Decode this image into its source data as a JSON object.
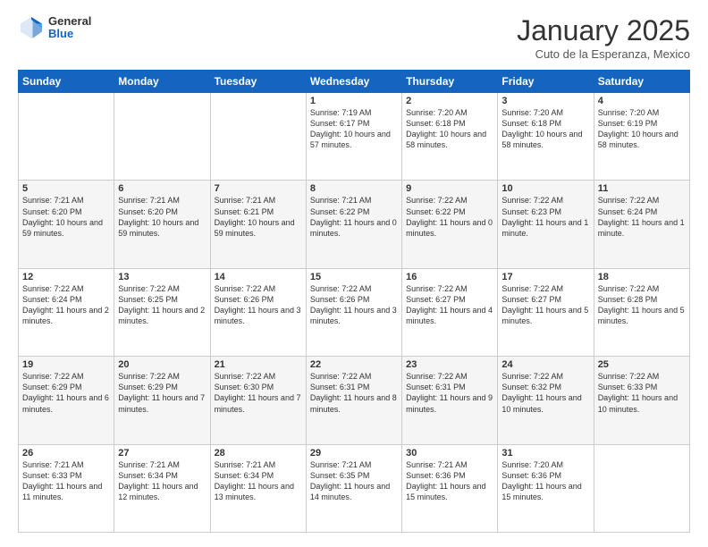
{
  "logo": {
    "general": "General",
    "blue": "Blue"
  },
  "header": {
    "month": "January 2025",
    "location": "Cuto de la Esperanza, Mexico"
  },
  "days_of_week": [
    "Sunday",
    "Monday",
    "Tuesday",
    "Wednesday",
    "Thursday",
    "Friday",
    "Saturday"
  ],
  "weeks": [
    [
      {
        "day": "",
        "info": ""
      },
      {
        "day": "",
        "info": ""
      },
      {
        "day": "",
        "info": ""
      },
      {
        "day": "1",
        "info": "Sunrise: 7:19 AM\nSunset: 6:17 PM\nDaylight: 10 hours and 57 minutes."
      },
      {
        "day": "2",
        "info": "Sunrise: 7:20 AM\nSunset: 6:18 PM\nDaylight: 10 hours and 58 minutes."
      },
      {
        "day": "3",
        "info": "Sunrise: 7:20 AM\nSunset: 6:18 PM\nDaylight: 10 hours and 58 minutes."
      },
      {
        "day": "4",
        "info": "Sunrise: 7:20 AM\nSunset: 6:19 PM\nDaylight: 10 hours and 58 minutes."
      }
    ],
    [
      {
        "day": "5",
        "info": "Sunrise: 7:21 AM\nSunset: 6:20 PM\nDaylight: 10 hours and 59 minutes."
      },
      {
        "day": "6",
        "info": "Sunrise: 7:21 AM\nSunset: 6:20 PM\nDaylight: 10 hours and 59 minutes."
      },
      {
        "day": "7",
        "info": "Sunrise: 7:21 AM\nSunset: 6:21 PM\nDaylight: 10 hours and 59 minutes."
      },
      {
        "day": "8",
        "info": "Sunrise: 7:21 AM\nSunset: 6:22 PM\nDaylight: 11 hours and 0 minutes."
      },
      {
        "day": "9",
        "info": "Sunrise: 7:22 AM\nSunset: 6:22 PM\nDaylight: 11 hours and 0 minutes."
      },
      {
        "day": "10",
        "info": "Sunrise: 7:22 AM\nSunset: 6:23 PM\nDaylight: 11 hours and 1 minute."
      },
      {
        "day": "11",
        "info": "Sunrise: 7:22 AM\nSunset: 6:24 PM\nDaylight: 11 hours and 1 minute."
      }
    ],
    [
      {
        "day": "12",
        "info": "Sunrise: 7:22 AM\nSunset: 6:24 PM\nDaylight: 11 hours and 2 minutes."
      },
      {
        "day": "13",
        "info": "Sunrise: 7:22 AM\nSunset: 6:25 PM\nDaylight: 11 hours and 2 minutes."
      },
      {
        "day": "14",
        "info": "Sunrise: 7:22 AM\nSunset: 6:26 PM\nDaylight: 11 hours and 3 minutes."
      },
      {
        "day": "15",
        "info": "Sunrise: 7:22 AM\nSunset: 6:26 PM\nDaylight: 11 hours and 3 minutes."
      },
      {
        "day": "16",
        "info": "Sunrise: 7:22 AM\nSunset: 6:27 PM\nDaylight: 11 hours and 4 minutes."
      },
      {
        "day": "17",
        "info": "Sunrise: 7:22 AM\nSunset: 6:27 PM\nDaylight: 11 hours and 5 minutes."
      },
      {
        "day": "18",
        "info": "Sunrise: 7:22 AM\nSunset: 6:28 PM\nDaylight: 11 hours and 5 minutes."
      }
    ],
    [
      {
        "day": "19",
        "info": "Sunrise: 7:22 AM\nSunset: 6:29 PM\nDaylight: 11 hours and 6 minutes."
      },
      {
        "day": "20",
        "info": "Sunrise: 7:22 AM\nSunset: 6:29 PM\nDaylight: 11 hours and 7 minutes."
      },
      {
        "day": "21",
        "info": "Sunrise: 7:22 AM\nSunset: 6:30 PM\nDaylight: 11 hours and 7 minutes."
      },
      {
        "day": "22",
        "info": "Sunrise: 7:22 AM\nSunset: 6:31 PM\nDaylight: 11 hours and 8 minutes."
      },
      {
        "day": "23",
        "info": "Sunrise: 7:22 AM\nSunset: 6:31 PM\nDaylight: 11 hours and 9 minutes."
      },
      {
        "day": "24",
        "info": "Sunrise: 7:22 AM\nSunset: 6:32 PM\nDaylight: 11 hours and 10 minutes."
      },
      {
        "day": "25",
        "info": "Sunrise: 7:22 AM\nSunset: 6:33 PM\nDaylight: 11 hours and 10 minutes."
      }
    ],
    [
      {
        "day": "26",
        "info": "Sunrise: 7:21 AM\nSunset: 6:33 PM\nDaylight: 11 hours and 11 minutes."
      },
      {
        "day": "27",
        "info": "Sunrise: 7:21 AM\nSunset: 6:34 PM\nDaylight: 11 hours and 12 minutes."
      },
      {
        "day": "28",
        "info": "Sunrise: 7:21 AM\nSunset: 6:34 PM\nDaylight: 11 hours and 13 minutes."
      },
      {
        "day": "29",
        "info": "Sunrise: 7:21 AM\nSunset: 6:35 PM\nDaylight: 11 hours and 14 minutes."
      },
      {
        "day": "30",
        "info": "Sunrise: 7:21 AM\nSunset: 6:36 PM\nDaylight: 11 hours and 15 minutes."
      },
      {
        "day": "31",
        "info": "Sunrise: 7:20 AM\nSunset: 6:36 PM\nDaylight: 11 hours and 15 minutes."
      },
      {
        "day": "",
        "info": ""
      }
    ]
  ]
}
